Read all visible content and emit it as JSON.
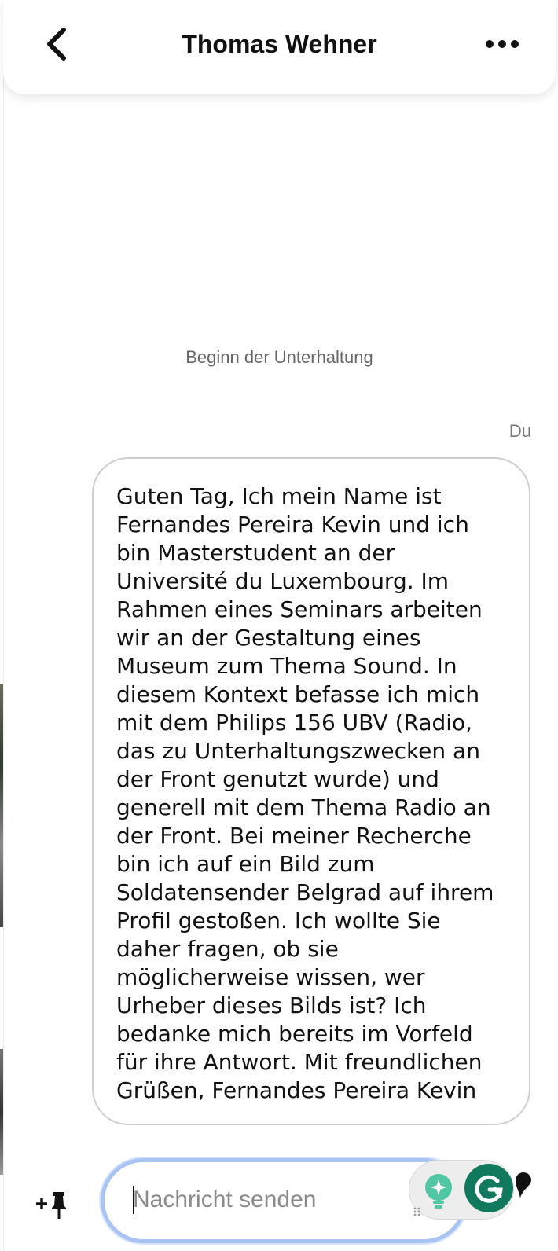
{
  "header": {
    "back_icon": "chevron-left-icon",
    "title": "Thomas Wehner",
    "more_icon": "more-horizontal-icon"
  },
  "conversation": {
    "start_label": "Beginn der Unterhaltung",
    "messages": [
      {
        "sender": "Du",
        "text": "Guten Tag, Ich mein Name ist Fernandes Pereira Kevin und ich bin Masterstudent an der Université du Luxembourg. Im Rahmen eines Seminars arbeiten wir an der Gestaltung eines Museum zum Thema Sound. In diesem Kontext befasse ich mich mit dem Philips 156 UBV (Radio, das zu Unterhaltungszwecken an der Front genutzt wurde) und generell mit dem Thema Radio an der Front. Bei meiner Recherche bin ich auf ein Bild zum Soldatensender Belgrad auf ihrem Profil gestoßen. Ich wollte Sie daher fragen, ob sie möglicherweise wissen, wer Urheber dieses Bilds ist? Ich bedanke mich bereits im Vorfeld für ihre Antwort. Mit freundlichen Grüßen, Fernandes Pereira Kevin"
      }
    ]
  },
  "composer": {
    "add_pin_icon": "add-pin-icon",
    "placeholder": "Nachricht senden",
    "value": "",
    "assistant_icons": [
      "lightbulb-sparkle-icon",
      "grammarly-g-icon"
    ],
    "send_icon": "send-icon"
  },
  "colors": {
    "accent_focus": "#a9c4f3",
    "grammarly_green": "#117a5e",
    "bulb_green": "#4fc7a4"
  }
}
